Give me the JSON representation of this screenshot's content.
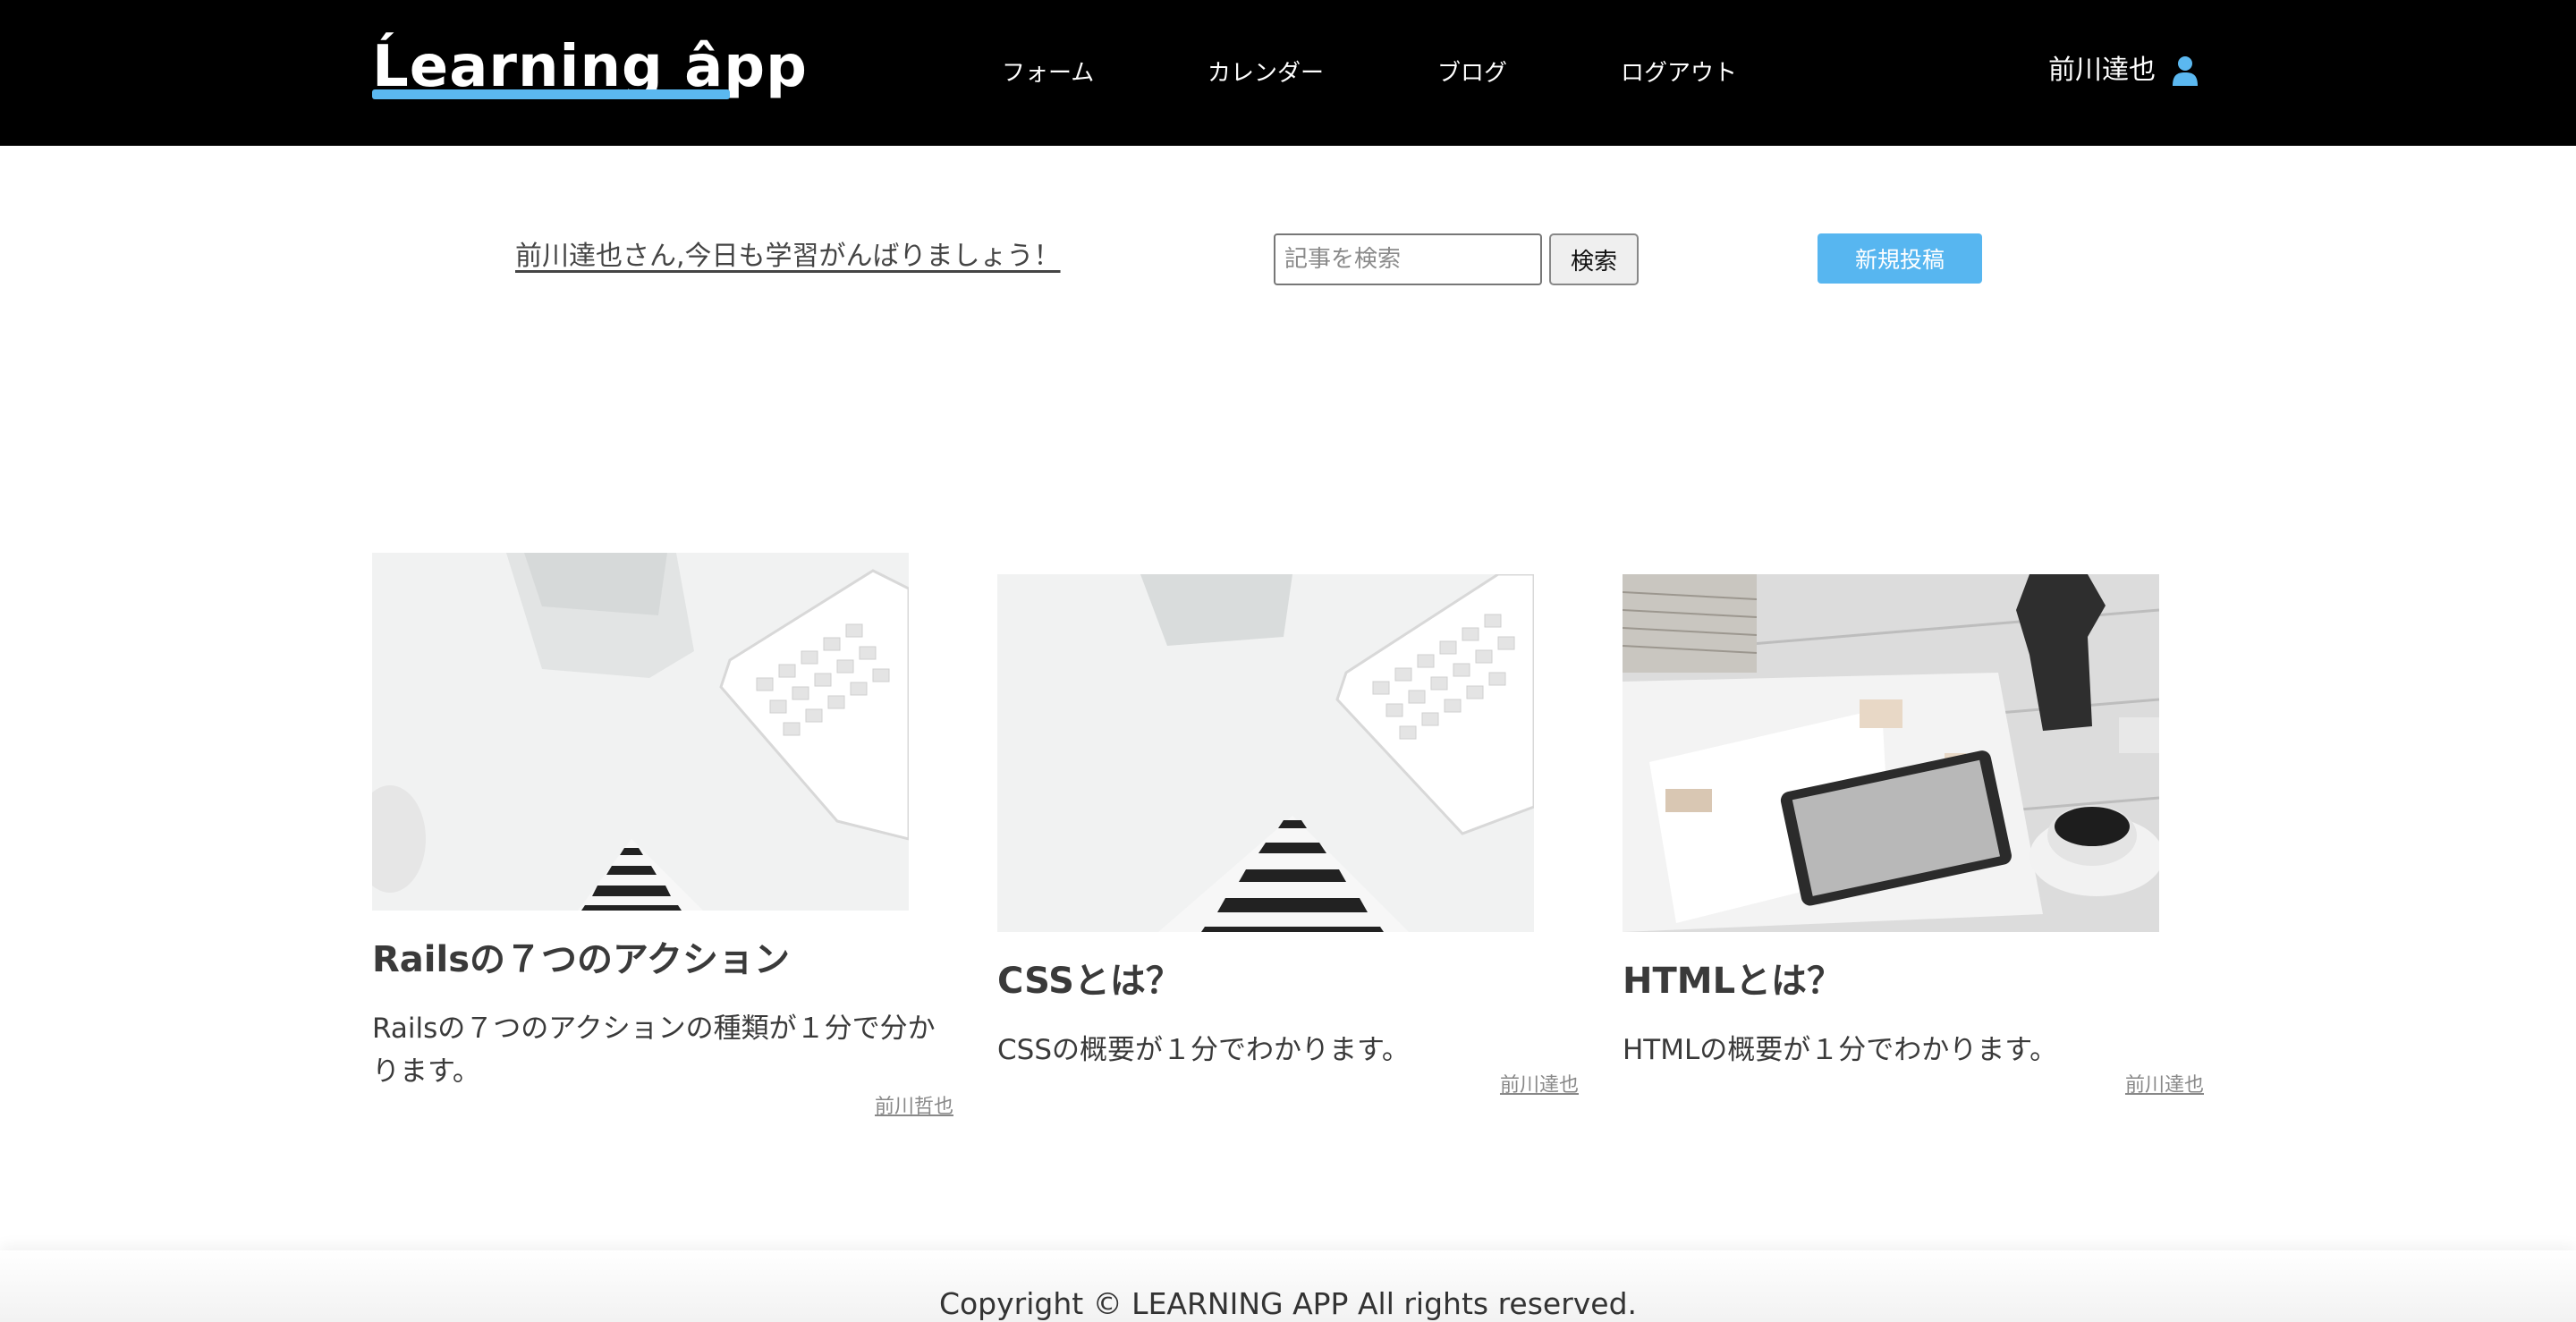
{
  "header": {
    "logo": "Ĺearning âpp",
    "nav": [
      "フォーム",
      "カレンダー",
      "ブログ",
      "ログアウト"
    ],
    "user_name": "前川達也"
  },
  "toolbar": {
    "greeting": "前川達也さん,今日も学習がんばりましょう！",
    "search_placeholder": "記事を検索",
    "search_button": "検索",
    "new_post_button": "新規投稿"
  },
  "posts": [
    {
      "title": "Railsの７つのアクション",
      "excerpt": "Railsの７つのアクションの種類が１分で分かります。",
      "author": "前川哲也"
    },
    {
      "title": "CSSとは？",
      "excerpt": "CSSの概要が１分でわかります。",
      "author": "前川達也"
    },
    {
      "title": "HTMLとは？",
      "excerpt": "HTMLの概要が１分でわかります。",
      "author": "前川達也"
    }
  ],
  "footer": {
    "copyright": "Copyright © LEARNING APP All rights reserved."
  },
  "colors": {
    "header_bg": "#000000",
    "accent": "#57b6f0",
    "text": "#333333"
  }
}
